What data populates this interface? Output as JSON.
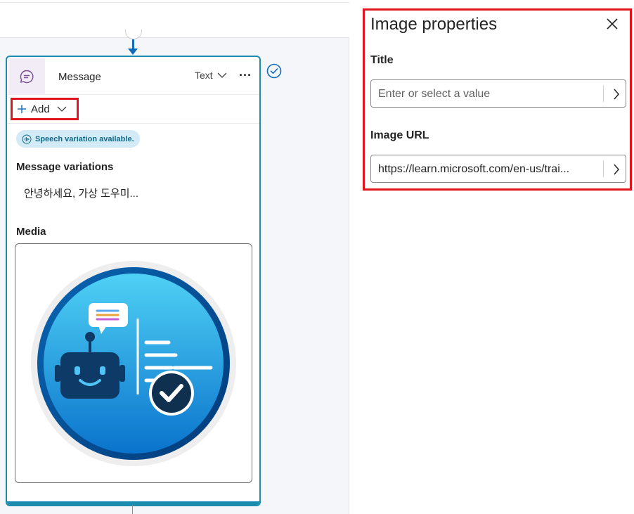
{
  "message_node": {
    "title": "Message",
    "type_dropdown": "Text",
    "more_label": "···",
    "add_label": "Add",
    "speech_badge": "Speech variation available.",
    "variations_label": "Message variations",
    "variation_text": "안녕하세요, 가상 도우미...",
    "media_label": "Media"
  },
  "panel": {
    "title": "Image properties",
    "title_field": {
      "label": "Title",
      "placeholder": "Enter or select a value"
    },
    "url_field": {
      "label": "Image URL",
      "value": "https://learn.microsoft.com/en-us/trai..."
    }
  },
  "colors": {
    "accent": "#1a8cad",
    "highlight": "#e0161c",
    "badge_bg": "#d3eaf7"
  },
  "icons": [
    "message-icon",
    "chevron-down-icon",
    "more-icon",
    "plus-icon",
    "speech-icon",
    "check-circle-icon",
    "close-icon",
    "chevron-right-icon",
    "bot-illustration"
  ]
}
